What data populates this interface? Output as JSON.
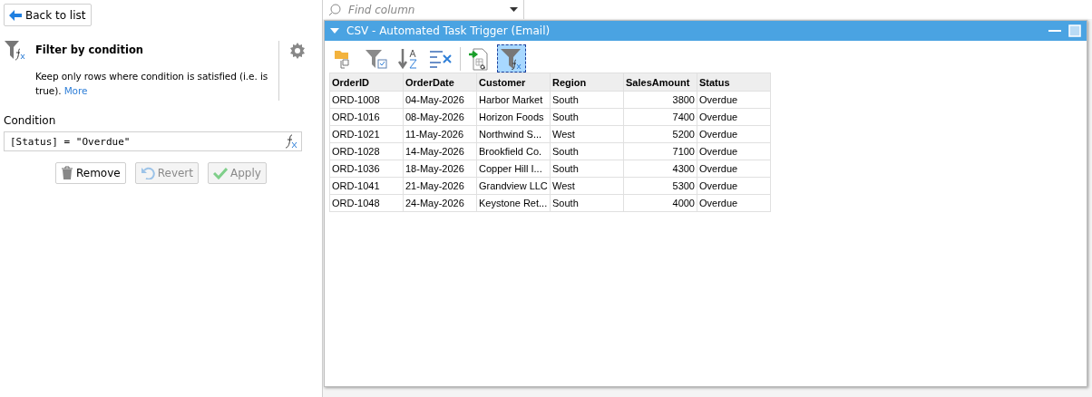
{
  "back_button": {
    "label": "Back to list"
  },
  "step": {
    "title": "Filter by condition",
    "description": "Keep only rows where condition is satisfied (i.e. is true).",
    "more_link": "More"
  },
  "condition": {
    "label": "Condition",
    "value": "[Status] = \"Overdue\""
  },
  "actions": [
    {
      "kind": "remove",
      "label": "Remove",
      "disabled": false
    },
    {
      "kind": "revert",
      "label": "Revert",
      "disabled": true
    },
    {
      "kind": "apply",
      "label": "Apply",
      "disabled": true
    }
  ],
  "find_column": {
    "placeholder": "Find column"
  },
  "window": {
    "title": "CSV - Automated Task Trigger (Email)"
  },
  "toolbar": [
    {
      "kind": "open",
      "selected": false
    },
    {
      "kind": "filter-check",
      "selected": false
    },
    {
      "kind": "sort",
      "selected": false
    },
    {
      "kind": "remove-columns",
      "selected": false
    },
    {
      "kind": "divider"
    },
    {
      "kind": "import",
      "selected": false
    },
    {
      "kind": "filter-fx",
      "selected": true
    }
  ],
  "table": {
    "columns": [
      "OrderID",
      "OrderDate",
      "Customer",
      "Region",
      "SalesAmount",
      "Status"
    ],
    "rows": [
      [
        "ORD-1008",
        "04-May-2026",
        "Harbor Market",
        "South",
        "3800",
        "Overdue"
      ],
      [
        "ORD-1016",
        "08-May-2026",
        "Horizon Foods",
        "South",
        "7400",
        "Overdue"
      ],
      [
        "ORD-1021",
        "11-May-2026",
        "Northwind S...",
        "West",
        "5200",
        "Overdue"
      ],
      [
        "ORD-1028",
        "14-May-2026",
        "Brookfield Co.",
        "South",
        "7100",
        "Overdue"
      ],
      [
        "ORD-1036",
        "18-May-2026",
        "Copper Hill I...",
        "South",
        "4300",
        "Overdue"
      ],
      [
        "ORD-1041",
        "21-May-2026",
        "Grandview LLC",
        "West",
        "5300",
        "Overdue"
      ],
      [
        "ORD-1048",
        "24-May-2026",
        "Keystone Ret...",
        "South",
        "4000",
        "Overdue"
      ]
    ]
  }
}
